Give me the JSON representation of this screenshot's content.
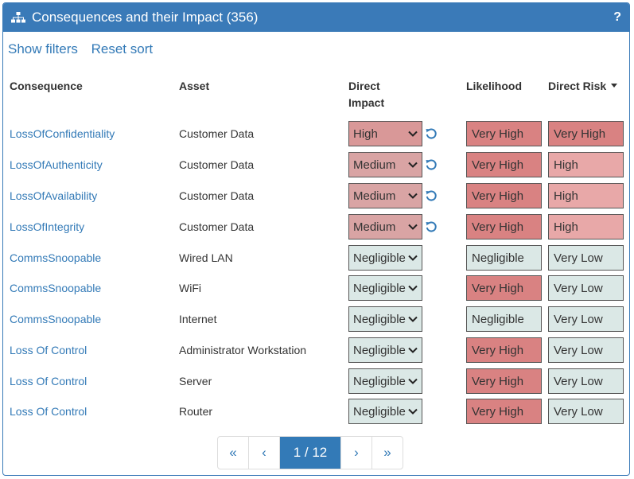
{
  "header": {
    "title": "Consequences and their Impact (356)",
    "help_label": "?"
  },
  "toolbar": {
    "show_filters": "Show filters",
    "reset_sort": "Reset sort"
  },
  "columns": {
    "consequence": "Consequence",
    "asset": "Asset",
    "direct_impact_1": "Direct",
    "direct_impact_2": "Impact",
    "likelihood": "Likelihood",
    "direct_risk": "Direct Risk"
  },
  "colors": {
    "Very High": "#d98282",
    "High": "#e8a8a8",
    "Medium": "#d9a4a4",
    "Negligible": "#dbe8e6",
    "Very Low": "#dbe8e6",
    "HighImpact": "#d99898",
    "header": "#3a7ab8"
  },
  "rows": [
    {
      "consequence": "LossOfConfidentiality",
      "asset": "Customer Data",
      "impact": "High",
      "reset": true,
      "likelihood": "Very High",
      "risk": "Very High"
    },
    {
      "consequence": "LossOfAuthenticity",
      "asset": "Customer Data",
      "impact": "Medium",
      "reset": true,
      "likelihood": "Very High",
      "risk": "High"
    },
    {
      "consequence": "LossOfAvailability",
      "asset": "Customer Data",
      "impact": "Medium",
      "reset": true,
      "likelihood": "Very High",
      "risk": "High"
    },
    {
      "consequence": "LossOfIntegrity",
      "asset": "Customer Data",
      "impact": "Medium",
      "reset": true,
      "likelihood": "Very High",
      "risk": "High"
    },
    {
      "consequence": "CommsSnoopable",
      "asset": "Wired LAN",
      "impact": "Negligible",
      "reset": false,
      "likelihood": "Negligible",
      "risk": "Very Low"
    },
    {
      "consequence": "CommsSnoopable",
      "asset": "WiFi",
      "impact": "Negligible",
      "reset": false,
      "likelihood": "Very High",
      "risk": "Very Low"
    },
    {
      "consequence": "CommsSnoopable",
      "asset": "Internet",
      "impact": "Negligible",
      "reset": false,
      "likelihood": "Negligible",
      "risk": "Very Low"
    },
    {
      "consequence": "Loss Of Control",
      "asset": "Administrator Workstation",
      "impact": "Negligible",
      "reset": false,
      "likelihood": "Very High",
      "risk": "Very Low"
    },
    {
      "consequence": "Loss Of Control",
      "asset": "Server",
      "impact": "Negligible",
      "reset": false,
      "likelihood": "Very High",
      "risk": "Very Low"
    },
    {
      "consequence": "Loss Of Control",
      "asset": "Router",
      "impact": "Negligible",
      "reset": false,
      "likelihood": "Very High",
      "risk": "Very Low"
    }
  ],
  "pagination": {
    "first": "«",
    "prev": "‹",
    "current": "1 / 12",
    "next": "›",
    "last": "»"
  }
}
